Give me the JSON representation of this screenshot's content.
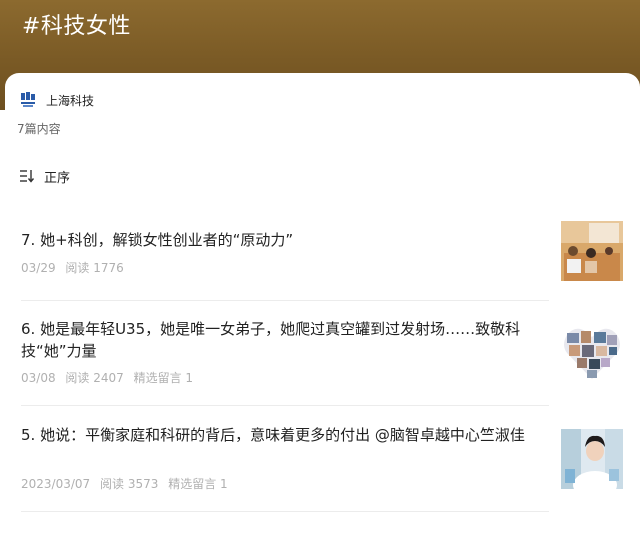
{
  "header": {
    "title": "#科技女性"
  },
  "account": {
    "name": "上海科技",
    "logo_icon": "shanghai-tech-logo-icon"
  },
  "count_text": "7篇内容",
  "sort": {
    "label": "正序",
    "icon": "sort-icon"
  },
  "articles": [
    {
      "title": "7. 她+科创，解锁女性创业者的“原动力”",
      "date": "03/29",
      "reads": "阅读 1776",
      "comments": ""
    },
    {
      "title": "6. 她是最年轻U35，她是唯一女弟子，她爬过真空罐到过发射场……致敬科技“她”力量",
      "date": "03/08",
      "reads": "阅读 2407",
      "comments": "精选留言 1"
    },
    {
      "title": "5. 她说：平衡家庭和科研的背后，意味着更多的付出 @脑智卓越中心竺淑佳",
      "date": "2023/03/07",
      "reads": "阅读 3573",
      "comments": "精选留言 1"
    }
  ],
  "colors": {
    "header": "#7a5a25",
    "meta": "#b0b0b0",
    "logo": "#2a5ba8"
  }
}
